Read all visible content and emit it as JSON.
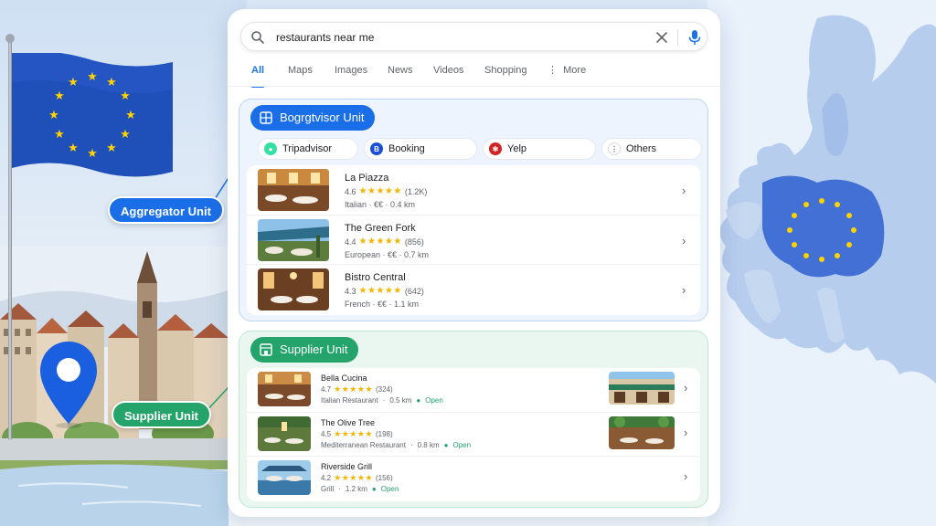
{
  "search": {
    "query": "restaurants near me"
  },
  "tabs": [
    {
      "label": "All",
      "active": true
    },
    {
      "label": "Maps"
    },
    {
      "label": "Images"
    },
    {
      "label": "News"
    },
    {
      "label": "Videos"
    },
    {
      "label": "Shopping"
    },
    {
      "label": "More"
    }
  ],
  "aggregator": {
    "unit_title": "Bogrgtvisor Unit",
    "callout_label": "Aggregator Unit",
    "sources": [
      {
        "label": "Tripadvisor",
        "color": "#34e0a1",
        "icon": "tripadvisor-icon"
      },
      {
        "label": "Booking",
        "color": "#1a4fd8",
        "icon": "booking-icon"
      },
      {
        "label": "Yelp",
        "color": "#d32323",
        "icon": "yelp-icon"
      },
      {
        "label": "Others",
        "color": "#5f6368",
        "icon": "more-vertical-icon"
      }
    ],
    "results": [
      {
        "name": "La Piazza",
        "rating": "4.6",
        "reviews": "(1.2K)",
        "meta": "Italian · €€ · 0.4 km"
      },
      {
        "name": "The Green Fork",
        "rating": "4.4",
        "reviews": "(856)",
        "meta": "European · €€ · 0.7 km"
      },
      {
        "name": "Bistro Central",
        "rating": "4.3",
        "reviews": "(642)",
        "meta": "French · €€ · 1.1 km"
      }
    ]
  },
  "supplier": {
    "unit_title": "Supplier Unit",
    "callout_label": "Supplier Unit",
    "results": [
      {
        "name": "Bella Cucina",
        "rating": "4.7",
        "reviews": "(324)",
        "category": "Italian Restaurant",
        "distance": "0.5 km",
        "status": "Open"
      },
      {
        "name": "The Olive Tree",
        "rating": "4.5",
        "reviews": "(198)",
        "category": "Mediterranean Restaurant",
        "distance": "0.8 km",
        "status": "Open"
      },
      {
        "name": "Riverside Grill",
        "rating": "4.2",
        "reviews": "(156)",
        "category": "Grill",
        "distance": "1.2 km",
        "status": "Open"
      }
    ]
  },
  "colors": {
    "accent_blue": "#1a6fe8",
    "accent_green": "#24a36b",
    "star": "#f4b400"
  }
}
